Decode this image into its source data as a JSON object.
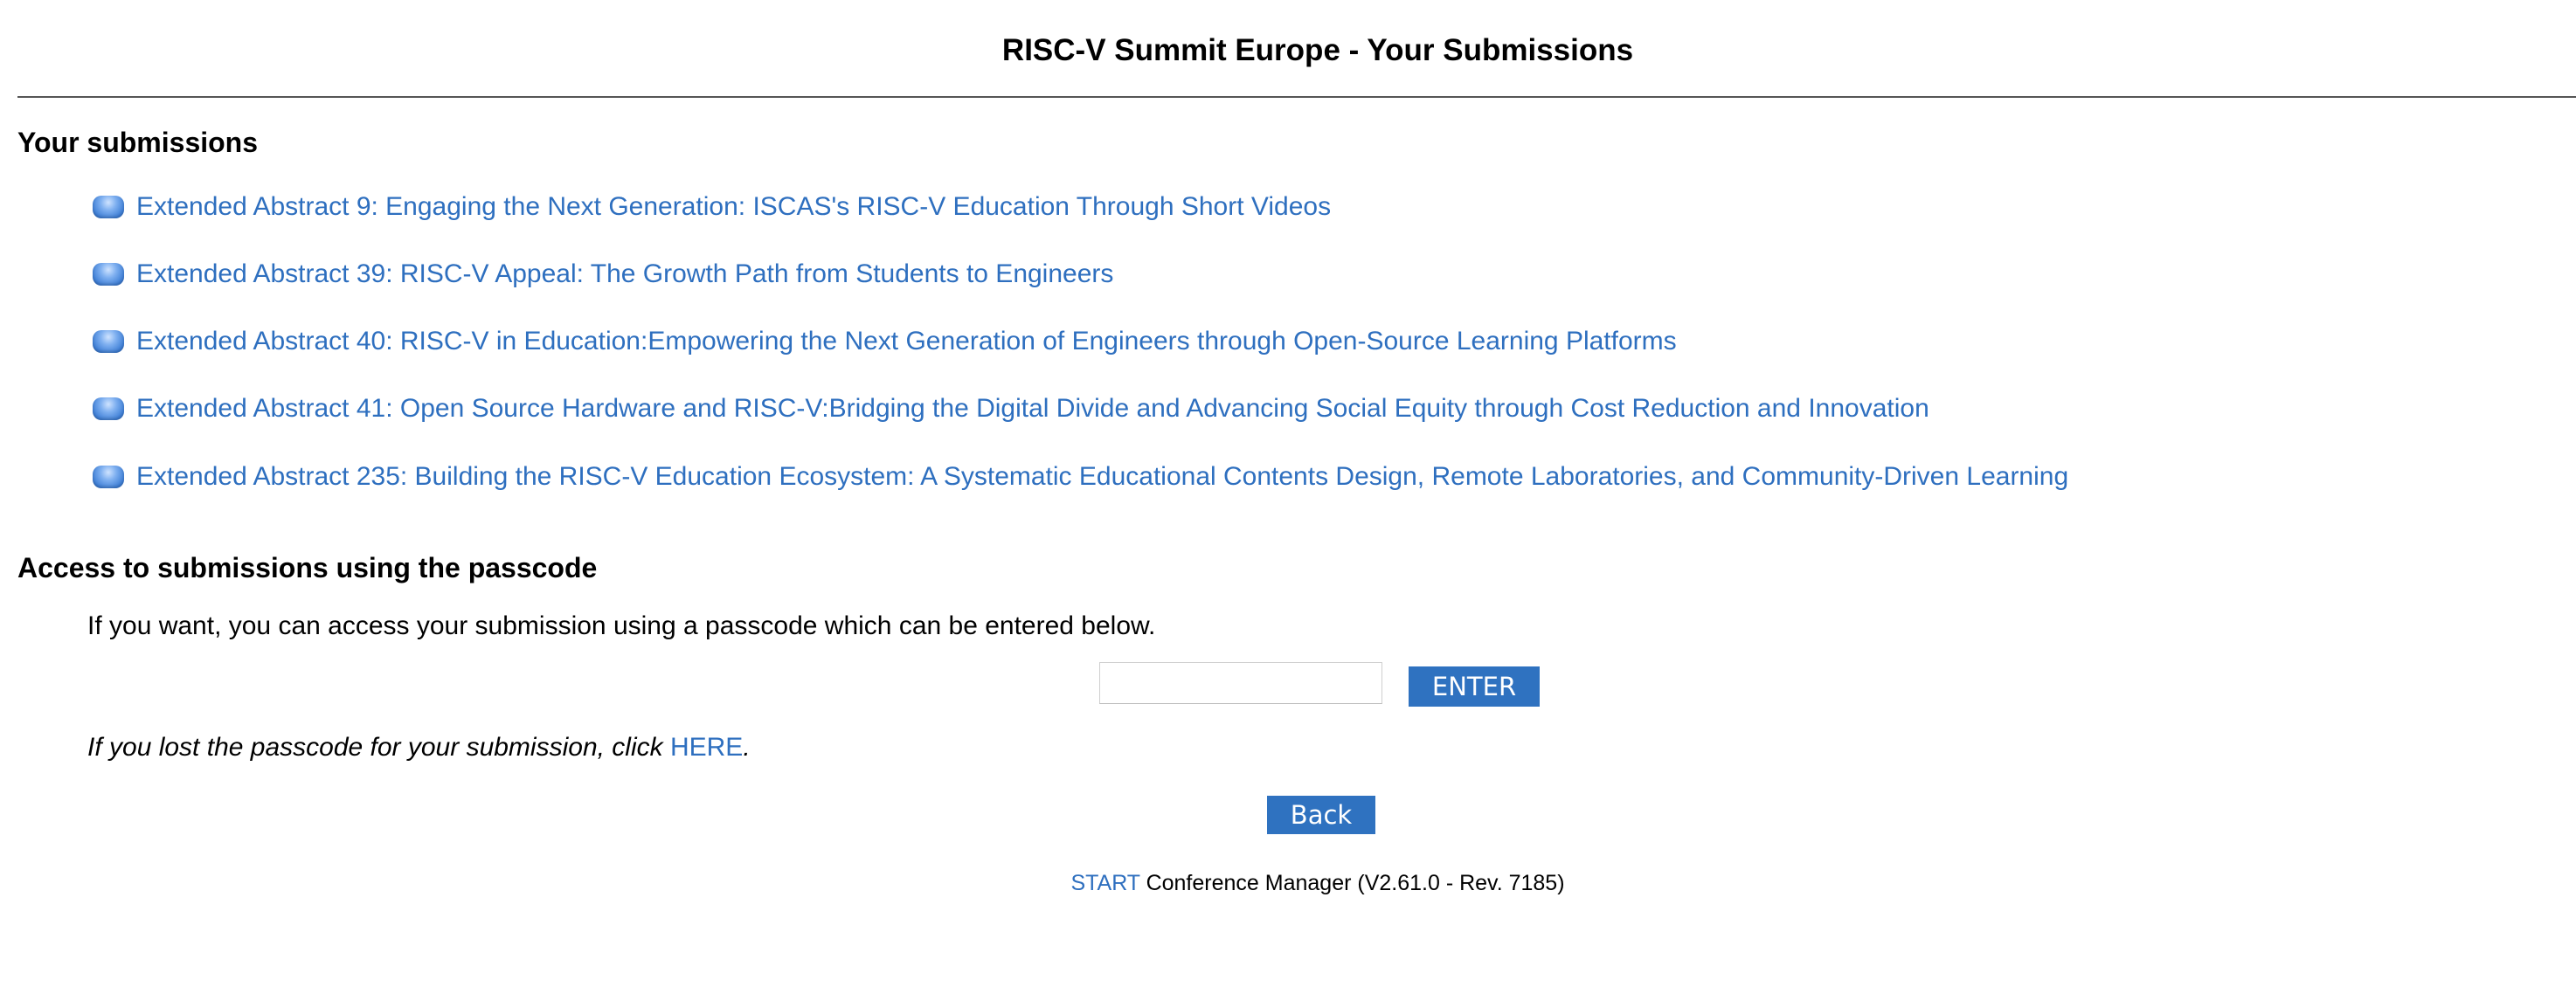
{
  "header": {
    "title": "RISC-V Summit Europe - Your Submissions"
  },
  "submissions_section": {
    "heading": "Your submissions",
    "icon": "blue-bullet-icon",
    "items": [
      {
        "label": "Extended Abstract 9: Engaging the Next Generation: ISCAS's RISC-V Education Through Short Videos"
      },
      {
        "label": "Extended Abstract 39: RISC-V Appeal: The Growth Path from Students to Engineers"
      },
      {
        "label": "Extended Abstract 40: RISC-V in Education:Empowering the Next Generation of Engineers through Open-Source Learning Platforms"
      },
      {
        "label": "Extended Abstract 41: Open Source Hardware and RISC-V:Bridging the Digital Divide and Advancing Social Equity through Cost Reduction and Innovation"
      },
      {
        "label": "Extended Abstract 235: Building the RISC-V Education Ecosystem: A Systematic Educational Contents Design, Remote Laboratories, and Community-Driven Learning"
      }
    ]
  },
  "passcode_section": {
    "heading": "Access to submissions using the passcode",
    "intro": "If you want, you can access your submission using a passcode which can be entered below.",
    "input_value": "",
    "enter_label": "ENTER",
    "lost_text": "If you lost the passcode for your submission, click ",
    "lost_link": "HERE",
    "lost_suffix": "."
  },
  "back_label": "Back",
  "footer": {
    "brand": "START",
    "text": " Conference Manager (V2.61.0 - Rev. 7185)"
  },
  "colors": {
    "link": "#2e6fbf",
    "button": "#2f72c0",
    "rule": "#555555"
  }
}
